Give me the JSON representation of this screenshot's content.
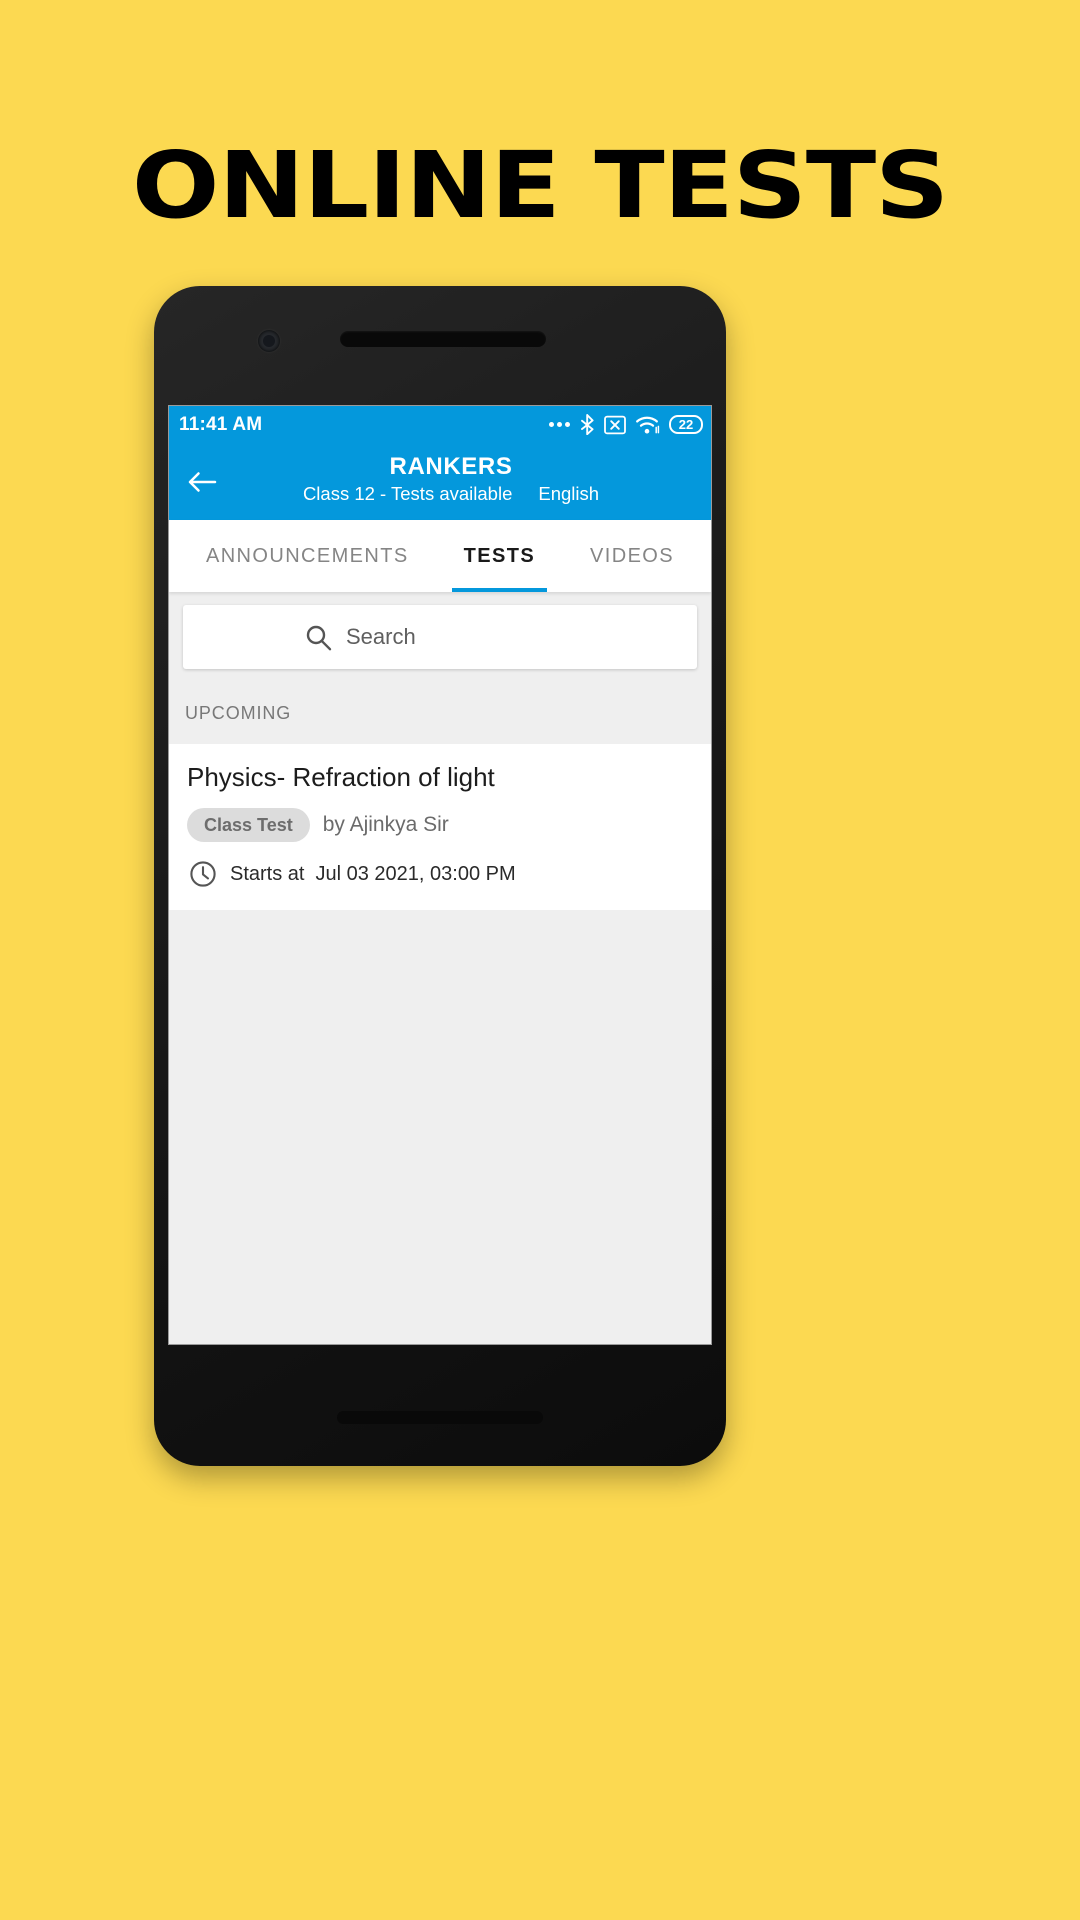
{
  "banner": {
    "headline": "ONLINE TESTS",
    "background_color": "#FCD951"
  },
  "theme": {
    "accent_blue": "#0498DC",
    "screen_bg": "#EFEFEF",
    "card_bg": "#FFFFFF",
    "chip_bg": "#DCDCDC"
  },
  "status_bar": {
    "time": "11:41 AM",
    "icons": [
      "more-dots-icon",
      "bluetooth-icon",
      "no-sim-icon",
      "wifi-icon",
      "battery-icon"
    ],
    "battery_level": "22"
  },
  "app_bar": {
    "back_icon": "arrow-left-icon",
    "title": "RANKERS",
    "subtitle_class": "Class 12 - Tests available",
    "subtitle_language": "English"
  },
  "tabs": [
    {
      "label": "ANNOUNCEMENTS",
      "active": false
    },
    {
      "label": "TESTS",
      "active": true
    },
    {
      "label": "VIDEOS",
      "active": false
    }
  ],
  "search": {
    "icon": "search-icon",
    "placeholder": "Search",
    "value": ""
  },
  "sections": [
    {
      "label": "UPCOMING",
      "items": [
        {
          "title": "Physics- Refraction of light",
          "chip": "Class Test",
          "author": "by Ajinkya Sir",
          "time_icon": "clock-icon",
          "time_label": "Starts at",
          "time_value": "Jul 03 2021, 03:00 PM"
        }
      ]
    }
  ]
}
